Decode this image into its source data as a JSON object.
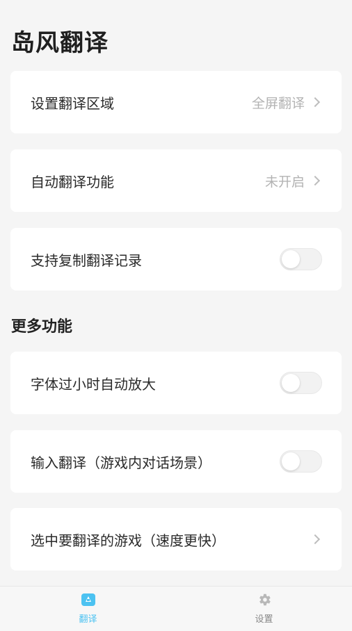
{
  "app": {
    "title": "岛风翻译"
  },
  "settings": [
    {
      "label": "设置翻译区域",
      "value": "全屏翻译"
    },
    {
      "label": "自动翻译功能",
      "value": "未开启"
    },
    {
      "label": "支持复制翻译记录"
    }
  ],
  "more": {
    "title": "更多功能",
    "items": [
      {
        "label": "字体过小时自动放大"
      },
      {
        "label": "输入翻译（游戏内对话场景）"
      },
      {
        "label": "选中要翻译的游戏（速度更快）"
      }
    ]
  },
  "toggles": {
    "copy_records": "off",
    "auto_enlarge": "off",
    "input_translate": "off"
  },
  "tabbar": {
    "tabs": [
      {
        "label": "翻译",
        "icon": "translate-icon",
        "active": true
      },
      {
        "label": "设置",
        "icon": "gear-icon",
        "active": false
      }
    ]
  },
  "colors": {
    "accent": "#4cc2f1",
    "background": "#f5f5f5",
    "card": "#ffffff",
    "muted": "#b3b3b3"
  }
}
